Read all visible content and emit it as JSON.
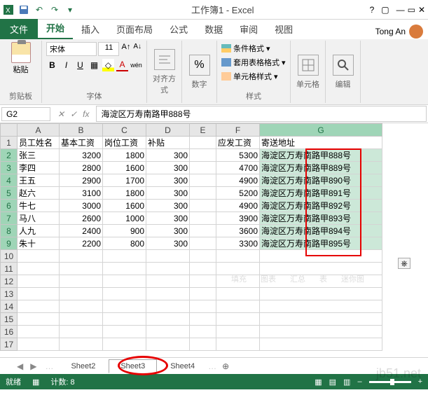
{
  "title": "工作簿1 - Excel",
  "user": "Tong An",
  "tabs": {
    "file": "文件",
    "home": "开始",
    "insert": "插入",
    "layout": "页面布局",
    "formula": "公式",
    "data": "数据",
    "review": "审阅",
    "view": "视图"
  },
  "ribbon": {
    "clipboard": {
      "paste": "粘贴",
      "label": "剪贴板"
    },
    "font": {
      "name": "宋体",
      "size": "11",
      "label": "字体",
      "bold": "B",
      "italic": "I",
      "underline": "U",
      "wen": "wén"
    },
    "align": {
      "label": "对齐方式"
    },
    "number": {
      "label": "数字",
      "percent": "%"
    },
    "styles": {
      "label": "样式",
      "cond": "条件格式",
      "table": "套用表格格式",
      "cell": "单元格样式"
    },
    "cells": {
      "label": "单元格"
    },
    "editing": {
      "label": "编辑"
    }
  },
  "formula_bar": {
    "name_box": "G2",
    "fx": "fx",
    "value": "海淀区万寿南路甲888号"
  },
  "columns": [
    "A",
    "B",
    "C",
    "D",
    "E",
    "F",
    "G"
  ],
  "headers": {
    "A": "员工姓名",
    "B": "基本工资",
    "C": "岗位工资",
    "D": "补贴",
    "E": "",
    "F": "应发工资",
    "G": "寄送地址"
  },
  "rows": [
    {
      "A": "张三",
      "B": 3200,
      "C": 1800,
      "D": 300,
      "F": 5300,
      "G": "海淀区万寿南路甲888号"
    },
    {
      "A": "李四",
      "B": 2800,
      "C": 1600,
      "D": 300,
      "F": 4700,
      "G": "海淀区万寿南路甲889号"
    },
    {
      "A": "王五",
      "B": 2900,
      "C": 1700,
      "D": 300,
      "F": 4900,
      "G": "海淀区万寿南路甲890号"
    },
    {
      "A": "赵六",
      "B": 3100,
      "C": 1800,
      "D": 300,
      "F": 5200,
      "G": "海淀区万寿南路甲891号"
    },
    {
      "A": "牛七",
      "B": 3000,
      "C": 1600,
      "D": 300,
      "F": 4900,
      "G": "海淀区万寿南路甲892号"
    },
    {
      "A": "马八",
      "B": 2600,
      "C": 1000,
      "D": 300,
      "F": 3900,
      "G": "海淀区万寿南路甲893号"
    },
    {
      "A": "人九",
      "B": 2400,
      "C": 900,
      "D": 300,
      "F": 3600,
      "G": "海淀区万寿南路甲894号"
    },
    {
      "A": "朱十",
      "B": 2200,
      "C": 800,
      "D": 300,
      "F": 3300,
      "G": "海淀区万寿南路甲895号"
    }
  ],
  "sheet_tabs": {
    "s2": "Sheet2",
    "s3": "Sheet3",
    "s4": "Sheet4",
    "active": "Sheet3"
  },
  "status": {
    "ready": "就绪",
    "count_label": "计数:",
    "count": 8
  },
  "quick_opts": {
    "fill": "填充",
    "chart": "图表",
    "summary": "汇总",
    "table": "表",
    "spark": "迷你图"
  },
  "watermark2": "jb51.net"
}
